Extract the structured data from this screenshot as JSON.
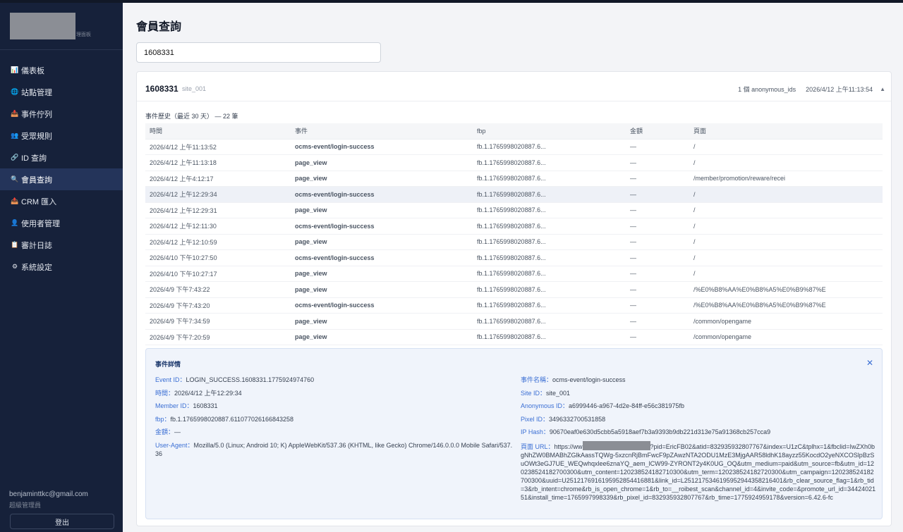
{
  "sidebar": {
    "logo_sub": "理面板",
    "items": [
      {
        "icon": "📊",
        "label": "儀表板"
      },
      {
        "icon": "🌐",
        "label": "站點管理"
      },
      {
        "icon": "📥",
        "label": "事件佇列"
      },
      {
        "icon": "👥",
        "label": "受眾規則"
      },
      {
        "icon": "🔗",
        "label": "ID 查詢"
      },
      {
        "icon": "🔍",
        "label": "會員查詢"
      },
      {
        "icon": "📤",
        "label": "CRM 匯入"
      },
      {
        "icon": "👤",
        "label": "使用者管理"
      },
      {
        "icon": "📋",
        "label": "審計日誌"
      },
      {
        "icon": "⚙",
        "label": "系統設定"
      }
    ],
    "active_index": 5,
    "user_email": "benjaminttkc@gmail.com",
    "user_role": "超級管理員",
    "logout_label": "登出"
  },
  "main": {
    "title": "會員查詢",
    "search_value": "1608331"
  },
  "card": {
    "member_id": "1608331",
    "site": "site_001",
    "anon_count": "1 個 anonymous_ids",
    "last_seen": "2026/4/12 上午11:13:54",
    "collapse_icon": "chevron-up-icon"
  },
  "history": {
    "title": "事件歷史（最近 30 天） — 22 筆",
    "columns": [
      "時間",
      "事件",
      "fbp",
      "金額",
      "頁面"
    ],
    "selected_row": 3,
    "rows": [
      [
        "2026/4/12 上午11:13:52",
        "ocms-event/login-success",
        "fb.1.1765998020887.6...",
        "—",
        "/"
      ],
      [
        "2026/4/12 上午11:13:18",
        "page_view",
        "fb.1.1765998020887.6...",
        "—",
        "/"
      ],
      [
        "2026/4/12 上午4:12:17",
        "page_view",
        "fb.1.1765998020887.6...",
        "—",
        "/member/promotion/reware/recei"
      ],
      [
        "2026/4/12 上午12:29:34",
        "ocms-event/login-success",
        "fb.1.1765998020887.6...",
        "—",
        "/"
      ],
      [
        "2026/4/12 上午12:29:31",
        "page_view",
        "fb.1.1765998020887.6...",
        "—",
        "/"
      ],
      [
        "2026/4/12 上午12:11:30",
        "ocms-event/login-success",
        "fb.1.1765998020887.6...",
        "—",
        "/"
      ],
      [
        "2026/4/12 上午12:10:59",
        "page_view",
        "fb.1.1765998020887.6...",
        "—",
        "/"
      ],
      [
        "2026/4/10 下午10:27:50",
        "ocms-event/login-success",
        "fb.1.1765998020887.6...",
        "—",
        "/"
      ],
      [
        "2026/4/10 下午10:27:17",
        "page_view",
        "fb.1.1765998020887.6...",
        "—",
        "/"
      ],
      [
        "2026/4/9 下午7:43:22",
        "page_view",
        "fb.1.1765998020887.6...",
        "—",
        "/%E0%B8%AA%E0%B8%A5%E0%B9%87%E"
      ],
      [
        "2026/4/9 下午7:43:20",
        "ocms-event/login-success",
        "fb.1.1765998020887.6...",
        "—",
        "/%E0%B8%AA%E0%B8%A5%E0%B9%87%E"
      ],
      [
        "2026/4/9 下午7:34:59",
        "page_view",
        "fb.1.1765998020887.6...",
        "—",
        "/common/opengame"
      ],
      [
        "2026/4/9 下午7:20:59",
        "page_view",
        "fb.1.1765998020887.6...",
        "—",
        "/common/opengame"
      ]
    ]
  },
  "detail": {
    "title": "事件詳情",
    "left": [
      {
        "label": "Event ID：",
        "value": "LOGIN_SUCCESS.1608331.1775924974760"
      },
      {
        "label": "時間：",
        "value": "2026/4/12 上午12:29:34"
      },
      {
        "label": "Member ID：",
        "value": "1608331"
      },
      {
        "label": "fbp：",
        "value": "fb.1.1765998020887.611077026166843258"
      },
      {
        "label": "金額：",
        "value": "—"
      },
      {
        "label": "User-Agent：",
        "value": "Mozilla/5.0 (Linux; Android 10; K) AppleWebKit/537.36 (KHTML, like Gecko) Chrome/146.0.0.0 Mobile Safari/537.36"
      }
    ],
    "right": [
      {
        "label": "事件名稱：",
        "value": "ocms-event/login-success"
      },
      {
        "label": "Site ID：",
        "value": "site_001"
      },
      {
        "label": "Anonymous ID：",
        "value": "a6999446-a967-4d2e-84ff-e56c381975fb"
      },
      {
        "label": "Pixel ID：",
        "value": "3496332700531858"
      },
      {
        "label": "IP Hash：",
        "value": "90670eaf0e630d5cbb5a5918aef7b3a9393b9db221d313e75a91368cb257cca9"
      }
    ],
    "page_url_label": "頁面 URL：",
    "page_url_prefix": "https://ww",
    "page_url_rest": "?pid=EricFB02&atid=832935932807767&index=U1zC&tplhx=1&fbclid=IwZXh0bgNhZW0BMABhZGlkAassTQWg-5xzcnRjBmFwcF9pZAwzNTA2ODU1MzE3MjgAAR58ldhK18ayzz55KocdO2yeNXCOSlpBzSuOWt3eGJ7UE_WEQwhqxlee6znaYQ_aem_lCW99-ZYRONT2y4K0UG_OQ&utm_medium=paid&utm_source=fb&utm_id=120238524182700300&utm_content=120238524182710300&utm_term=120238524182720300&utm_campaign=120238524182700300&uuid=U2512176916195952854416881&link_id=L2512175346195952944358216401&rb_clear_source_flag=1&rb_tid=3&rb_intent=chrome&rb_is_open_chrome=1&rb_to=__roibest_scan&channel_id=4&invite_code=&promote_url_id=3442402151&install_time=1765997998339&rb_pixel_id=832935932807767&rb_time=1775924959178&version=6.42.6-fc"
  }
}
